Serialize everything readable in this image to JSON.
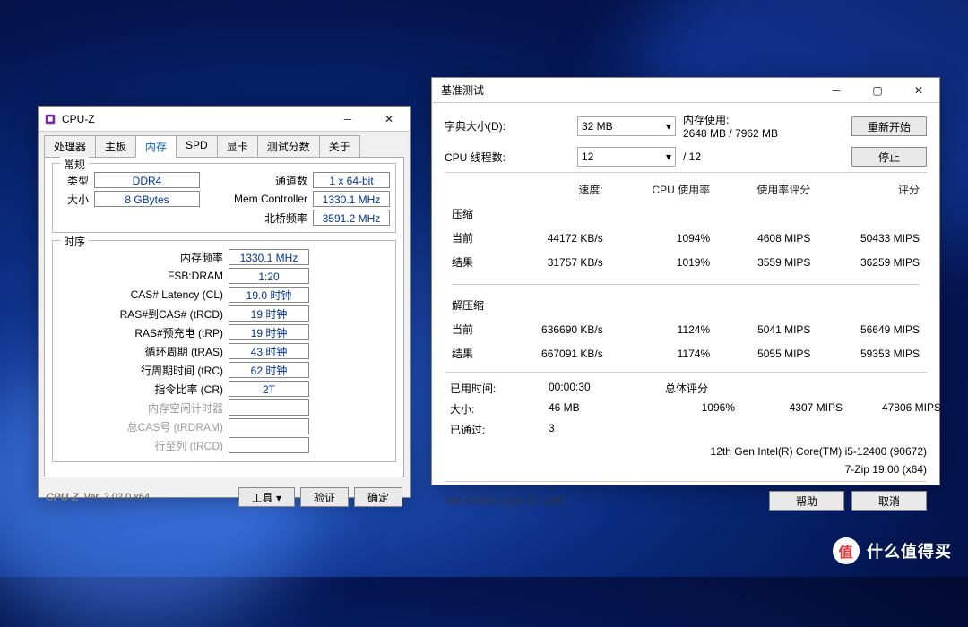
{
  "cpuz": {
    "title": "CPU-Z",
    "tabs": [
      "处理器",
      "主板",
      "内存",
      "SPD",
      "显卡",
      "测试分数",
      "关于"
    ],
    "active_tab_index": 2,
    "general": {
      "legend": "常规",
      "type_label": "类型",
      "type_value": "DDR4",
      "size_label": "大小",
      "size_value": "8 GBytes",
      "channels_label": "通道数",
      "channels_value": "1 x 64-bit",
      "mc_label": "Mem Controller",
      "mc_value": "1330.1 MHz",
      "nb_label": "北桥频率",
      "nb_value": "3591.2 MHz"
    },
    "timings": {
      "legend": "时序",
      "rows": [
        {
          "label": "内存频率",
          "value": "1330.1 MHz"
        },
        {
          "label": "FSB:DRAM",
          "value": "1:20"
        },
        {
          "label": "CAS# Latency (CL)",
          "value": "19.0 时钟"
        },
        {
          "label": "RAS#到CAS# (tRCD)",
          "value": "19 时钟"
        },
        {
          "label": "RAS#预充电 (tRP)",
          "value": "19 时钟"
        },
        {
          "label": "循环周期 (tRAS)",
          "value": "43 时钟"
        },
        {
          "label": "行周期时间 (tRC)",
          "value": "62 时钟"
        },
        {
          "label": "指令比率 (CR)",
          "value": "2T"
        }
      ],
      "disabled": [
        {
          "label": "内存空闲计时器"
        },
        {
          "label": "总CAS号 (tRDRAM)"
        },
        {
          "label": "行至列 (tRCD)"
        }
      ]
    },
    "footer": {
      "logo": "CPU-Z",
      "version": "Ver. 2.02.0.x64",
      "tools": "工具",
      "validate": "验证",
      "ok": "确定"
    }
  },
  "bench": {
    "title": "基准测试",
    "dict_label": "字典大小(D):",
    "dict_value": "32 MB",
    "mem_label": "内存使用:",
    "mem_value": "2648 MB / 7962 MB",
    "restart": "重新开始",
    "threads_label": "CPU 线程数:",
    "threads_value": "12",
    "threads_total": "/ 12",
    "stop": "停止",
    "cols": {
      "speed": "速度:",
      "cpu": "CPU 使用率",
      "eff": "使用率评分",
      "score": "评分"
    },
    "compress": {
      "title": "压缩",
      "current_label": "当前",
      "current": {
        "speed": "44172 KB/s",
        "cpu": "1094%",
        "eff": "4608 MIPS",
        "score": "50433 MIPS"
      },
      "result_label": "结果",
      "result": {
        "speed": "31757 KB/s",
        "cpu": "1019%",
        "eff": "3559 MIPS",
        "score": "36259 MIPS"
      }
    },
    "decompress": {
      "title": "解压缩",
      "current_label": "当前",
      "current": {
        "speed": "636690 KB/s",
        "cpu": "1124%",
        "eff": "5041 MIPS",
        "score": "56649 MIPS"
      },
      "result_label": "结果",
      "result": {
        "speed": "667091 KB/s",
        "cpu": "1174%",
        "eff": "5055 MIPS",
        "score": "59353 MIPS"
      }
    },
    "summary": {
      "elapsed_label": "已用时间:",
      "elapsed": "00:00:30",
      "overall_label": "总体评分",
      "size_label": "大小:",
      "size": "46 MB",
      "cpu": "1096%",
      "eff": "4307 MIPS",
      "score": "47806 MIPS",
      "passed_label": "已通过:",
      "passed": "3"
    },
    "hw1": "12th Gen Intel(R) Core(TM) i5-12400 (90672)",
    "hw2": "7-Zip 19.00 (x64)",
    "sig": "x64 6.9702 cpus:12 128T",
    "help": "帮助",
    "cancel": "取消"
  },
  "watermark": "什么值得买"
}
